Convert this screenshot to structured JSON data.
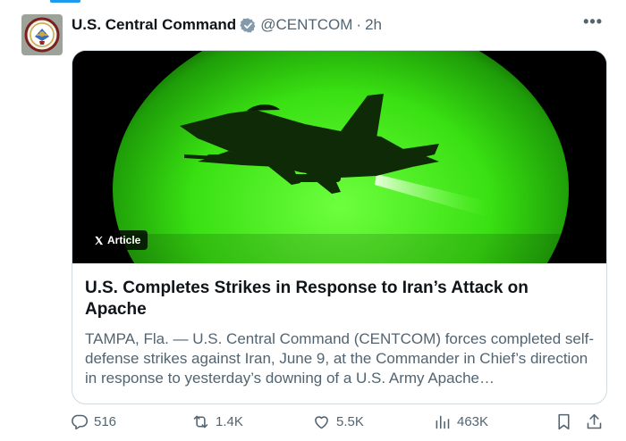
{
  "post": {
    "display_name": "U.S. Central Command",
    "handle": "@CENTCOM",
    "separator": "·",
    "time": "2h",
    "more_label": "•••"
  },
  "card": {
    "badge_label": "Article",
    "title": "U.S. Completes Strikes in Response to Iran’s Attack on Apache",
    "snippet": "TAMPA, Fla. — U.S. Central Command (CENTCOM) forces completed self-defense strikes against Iran, June 9, at the Commander in Chief’s direction in response to yesterday’s downing of a U.S. Army Apache…"
  },
  "actions": {
    "replies": "516",
    "reposts": "1.4K",
    "likes": "5.5K",
    "views": "463K"
  },
  "colors": {
    "accent": "#1d9bf0",
    "text_primary": "#0f1419",
    "text_secondary": "#536471",
    "night_vision_green": "#39ff14"
  },
  "icons": {
    "verified": "verified-badge-icon",
    "reply": "reply-icon",
    "repost": "repost-icon",
    "like": "heart-icon",
    "views": "bar-chart-icon",
    "bookmark": "bookmark-icon",
    "share": "share-icon",
    "x_logo": "x-logo-icon"
  }
}
